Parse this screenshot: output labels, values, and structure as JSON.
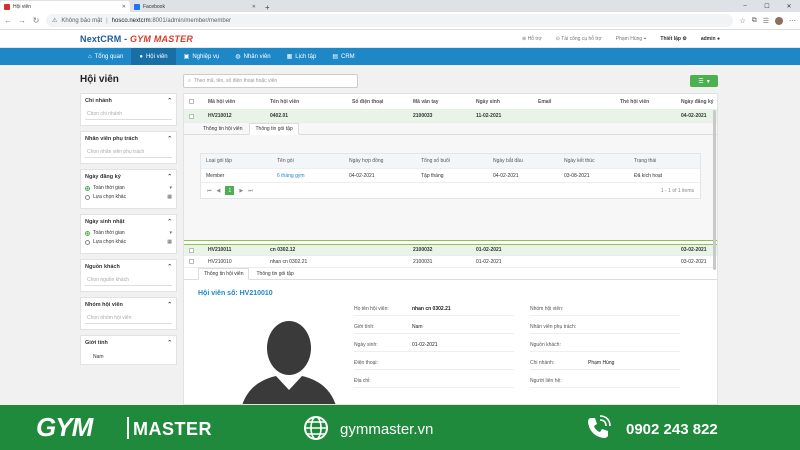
{
  "browser": {
    "tabs": [
      {
        "label": "Hội viên",
        "active": true
      },
      {
        "label": "Facebook",
        "active": false
      }
    ],
    "url_security": "Không bảo mật",
    "url_host": "hosco.nextcrm",
    "url_path": ":8001/admin/member/member"
  },
  "header": {
    "logo_a": "NextCRM",
    "logo_b": "GYM MASTER",
    "support": "Hỗ trợ",
    "guide": "Tài công cụ hỗ trợ",
    "user_name": "Phạm Hùng",
    "settings": "Thiết lập",
    "admin": "admin"
  },
  "nav": {
    "items": [
      {
        "label": "Tổng quan",
        "icon": "home-icon"
      },
      {
        "label": "Hội viên",
        "icon": "user-icon",
        "active": true
      },
      {
        "label": "Nghiệp vụ",
        "icon": "briefcase-icon"
      },
      {
        "label": "Nhân viên",
        "icon": "users-icon"
      },
      {
        "label": "Lịch tập",
        "icon": "calendar-icon"
      },
      {
        "label": "CRM",
        "icon": "crm-icon"
      }
    ]
  },
  "page": {
    "title": "Hội viên",
    "search_placeholder": "Theo mã, tên, số điện thoại hoặc viên"
  },
  "filters": {
    "branch": {
      "title": "Chi nhánh",
      "placeholder": "Chọn chi nhánh"
    },
    "staff": {
      "title": "Nhân viên phụ trách",
      "placeholder": "Chọn nhân viên phụ trách"
    },
    "register": {
      "title": "Ngày đăng ký",
      "opt1": "Toàn thời gian",
      "opt2": "Lựa chọn khác"
    },
    "birthday": {
      "title": "Ngày sinh nhật",
      "opt1": "Toàn thời gian",
      "opt2": "Lựa chọn khác"
    },
    "source": {
      "title": "Nguồn khách",
      "placeholder": "Chọn nguồn khách"
    },
    "group": {
      "title": "Nhóm hội viên",
      "placeholder": "Chọn nhóm hội viên"
    },
    "gender": {
      "title": "Giới tính",
      "opt1": "Nam"
    }
  },
  "table": {
    "headers": [
      "Mã hội viên",
      "Tên hội viên",
      "Số điện thoại",
      "Mã vân tay",
      "Ngày sinh",
      "Email",
      "Thẻ hội viên",
      "Ngày đăng ký"
    ],
    "rows": [
      {
        "code": "HV210012",
        "name": "0402.01",
        "phone": "",
        "finger": "2100033",
        "dob": "11-02-2021",
        "email": "",
        "card": "",
        "reg": "04-02-2021"
      },
      {
        "code": "HV210011",
        "name": "cn 0302.12",
        "phone": "",
        "finger": "2100032",
        "dob": "01-02-2021",
        "email": "",
        "card": "",
        "reg": "03-02-2021"
      },
      {
        "code": "HV210010",
        "name": "nhan cn 0302.21",
        "phone": "",
        "finger": "2100031",
        "dob": "01-02-2021",
        "email": "",
        "card": "",
        "reg": "03-02-2021"
      }
    ]
  },
  "subtabs": {
    "info": "Thông tin hội viên",
    "packages": "Thông tin gói tập"
  },
  "packages": {
    "headers": [
      "Loại gói tập",
      "Tên gói",
      "Ngày hợp đồng",
      "Tổng số buổi",
      "Ngày bắt đầu",
      "Ngày kết thúc",
      "Trạng thái"
    ],
    "row": [
      "Member",
      "6 tháng gym",
      "04-02-2021",
      "Tập tháng",
      "04-02-2021",
      "03-08-2021",
      "Đã kích hoạt"
    ],
    "page": "1",
    "pager_first": "⏮",
    "pager_prev": "◀",
    "pager_next": "▶",
    "pager_last": "⏭",
    "total": "1 - 1 of 1 items"
  },
  "detail": {
    "title": "Hội viên số: HV210010",
    "fields": [
      {
        "label": "Họ tên hội viên:",
        "value": "nhan cn 0302.21"
      },
      {
        "label": "Giới tính:",
        "value": "Nam"
      },
      {
        "label": "Ngày sinh:",
        "value": "01-02-2021"
      },
      {
        "label": "Điện thoại:",
        "value": ""
      },
      {
        "label": "Địa chỉ:",
        "value": ""
      }
    ],
    "fields_right": [
      {
        "label": "Nhóm hội viên:",
        "value": ""
      },
      {
        "label": "Nhân viên phụ trách:",
        "value": ""
      },
      {
        "label": "Nguồn khách:",
        "value": ""
      },
      {
        "label": "Chi nhánh:",
        "value": "Phạm Hùng"
      },
      {
        "label": "Người liên hệ:",
        "value": ""
      }
    ]
  },
  "footer": {
    "brand_a": "GYM",
    "brand_b": "MASTER",
    "website": "gymmaster.vn",
    "phone": "0902 243 822"
  },
  "colors": {
    "primary": "#1e88c7",
    "accent": "#4caf50",
    "footer": "#1f8a3c"
  }
}
